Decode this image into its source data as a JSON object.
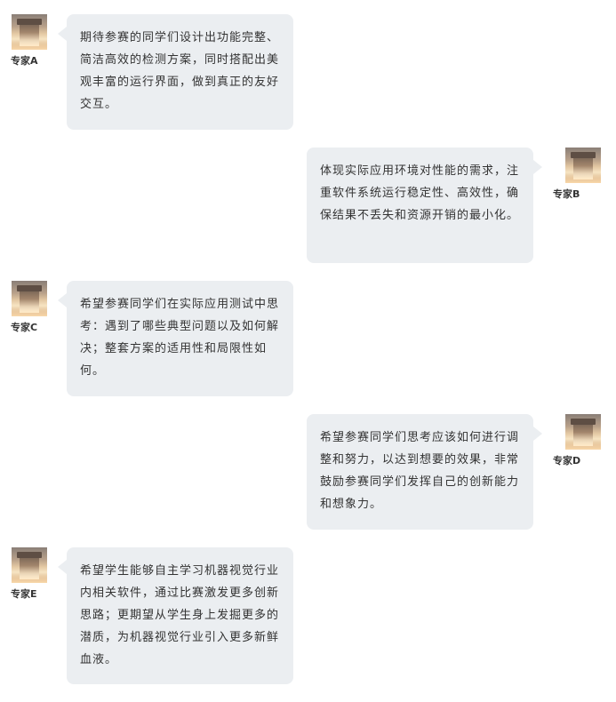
{
  "messages": [
    {
      "expert": "专家A",
      "side": "left",
      "text": "期待参赛的同学们设计出功能完整、简洁高效的检测方案，同时搭配出美观丰富的运行界面，做到真正的友好交互。"
    },
    {
      "expert": "专家B",
      "side": "right",
      "text": "体现实际应用环境对性能的需求，注重软件系统运行稳定性、高效性，确保结果不丢失和资源开销的最小化。"
    },
    {
      "expert": "专家C",
      "side": "left",
      "text": "希望参赛同学们在实际应用测试中思考：遇到了哪些典型问题以及如何解决；整套方案的适用性和局限性如何。"
    },
    {
      "expert": "专家D",
      "side": "right",
      "text": "希望参赛同学们思考应该如何进行调整和努力，以达到想要的效果，非常鼓励参赛同学们发挥自己的创新能力和想象力。"
    },
    {
      "expert": "专家E",
      "side": "left",
      "text": "希望学生能够自主学习机器视觉行业内相关软件，通过比赛激发更多创新思路；更期望从学生身上发掘更多的潜质，为机器视觉行业引入更多新鲜血液。"
    }
  ],
  "colors": {
    "bubble": "#ebeef1",
    "text": "#333333"
  },
  "icons": {
    "avatar": "expert-avatar-icon"
  }
}
